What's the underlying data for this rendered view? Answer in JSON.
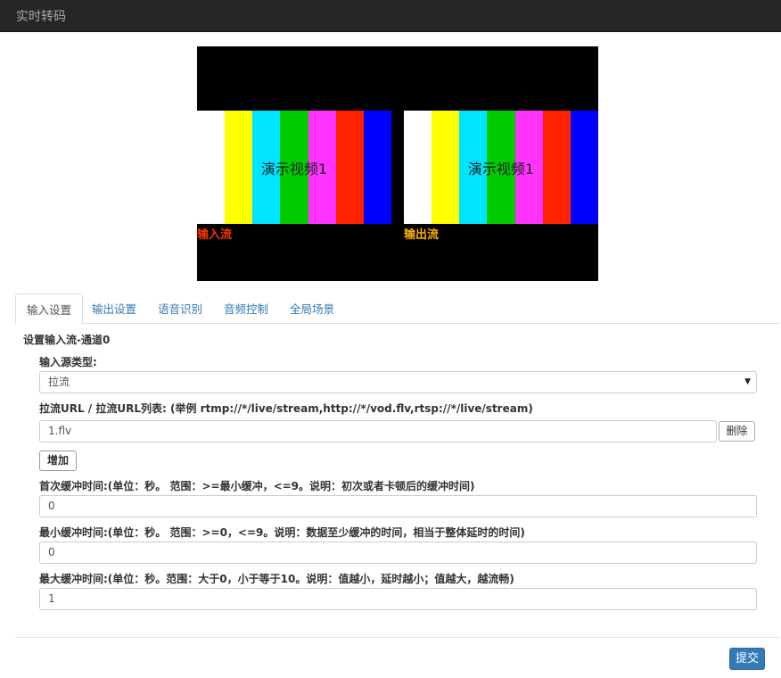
{
  "navbar": {
    "title": "实时转码"
  },
  "preview": {
    "bar_colors": [
      "#ffffff",
      "#ffff00",
      "#00e5ff",
      "#00cc00",
      "#ff33ff",
      "#ff2200",
      "#0000ff"
    ],
    "video_title": "演示视频1",
    "input_label": "输入流",
    "input_label_color": "#ff3300",
    "output_label": "输出流",
    "output_label_color": "#ffb000"
  },
  "tabs": [
    {
      "label": "输入设置",
      "active": true
    },
    {
      "label": "输出设置",
      "active": false
    },
    {
      "label": "语音识别",
      "active": false
    },
    {
      "label": "音频控制",
      "active": false
    },
    {
      "label": "全局场景",
      "active": false
    }
  ],
  "form": {
    "section_title": "设置输入流-通道0",
    "source_type_label": "输入源类型:",
    "source_type_value": "拉流",
    "url_label": "拉流URL / 拉流URL列表: (举例 rtmp://*/live/stream,http://*/vod.flv,rtsp://*/live/stream)",
    "url_value": "1.flv",
    "delete_label": "删除",
    "add_label": "增加",
    "first_buffer_label": "首次缓冲时间:(单位：秒。 范围：>=最小缓冲，<=9。说明：初次或者卡顿后的缓冲时间)",
    "first_buffer_value": "0",
    "min_buffer_label": "最小缓冲时间:(单位：秒。 范围：>=0，<=9。说明：数据至少缓冲的时间，相当于整体延时的时间)",
    "min_buffer_value": "0",
    "max_buffer_label": "最大缓冲时间:(单位：秒。范围：大于0，小于等于10。说明：值越小，延时越小；值越大，越流畅)",
    "max_buffer_value": "1",
    "submit_label": "提交"
  }
}
